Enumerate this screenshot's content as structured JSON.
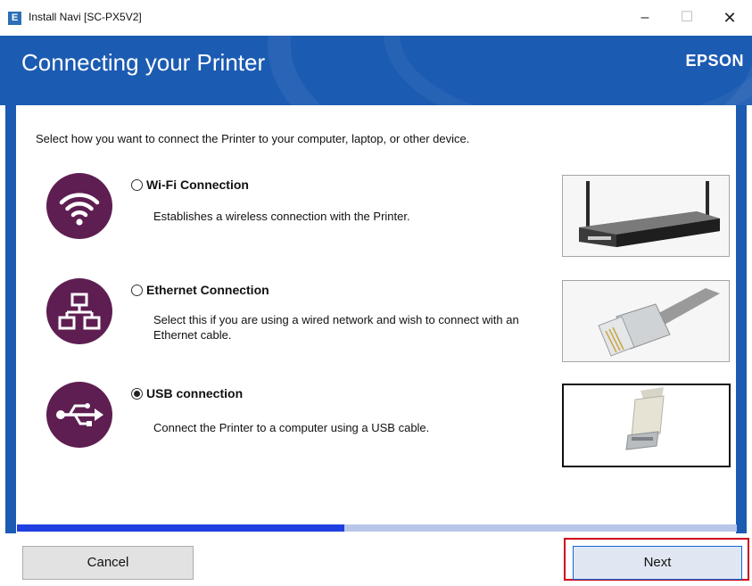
{
  "window": {
    "icon_letter": "E",
    "title": "Install Navi [SC-PX5V2]",
    "minimize_glyph": "–",
    "maximize_glyph": "☐",
    "close_glyph": "✕"
  },
  "header": {
    "title": "Connecting your Printer",
    "brand": "EPSON"
  },
  "intro_text": "Select how you want to connect the Printer to your computer, laptop, or other device.",
  "options": [
    {
      "label": "Wi-Fi Connection",
      "description": "Establishes a wireless connection with the Printer.",
      "selected": false,
      "icon": "wifi-icon",
      "image": "wireless-router-photo"
    },
    {
      "label": "Ethernet Connection",
      "description": "Select this if you are using a wired network and wish to connect with an Ethernet cable.",
      "selected": false,
      "icon": "network-icon",
      "image": "ethernet-cable-photo"
    },
    {
      "label": "USB connection",
      "description": "Connect the Printer to a computer using a USB cable.",
      "selected": true,
      "icon": "usb-icon",
      "image": "usb-cable-photo"
    }
  ],
  "progress": {
    "fraction": 0.455
  },
  "buttons": {
    "cancel": "Cancel",
    "next": "Next"
  },
  "colors": {
    "header_blue": "#1c5bb2",
    "icon_plum": "#5e1e51",
    "progress_fill": "#1f3fe0",
    "highlight_red": "#d0021b"
  }
}
